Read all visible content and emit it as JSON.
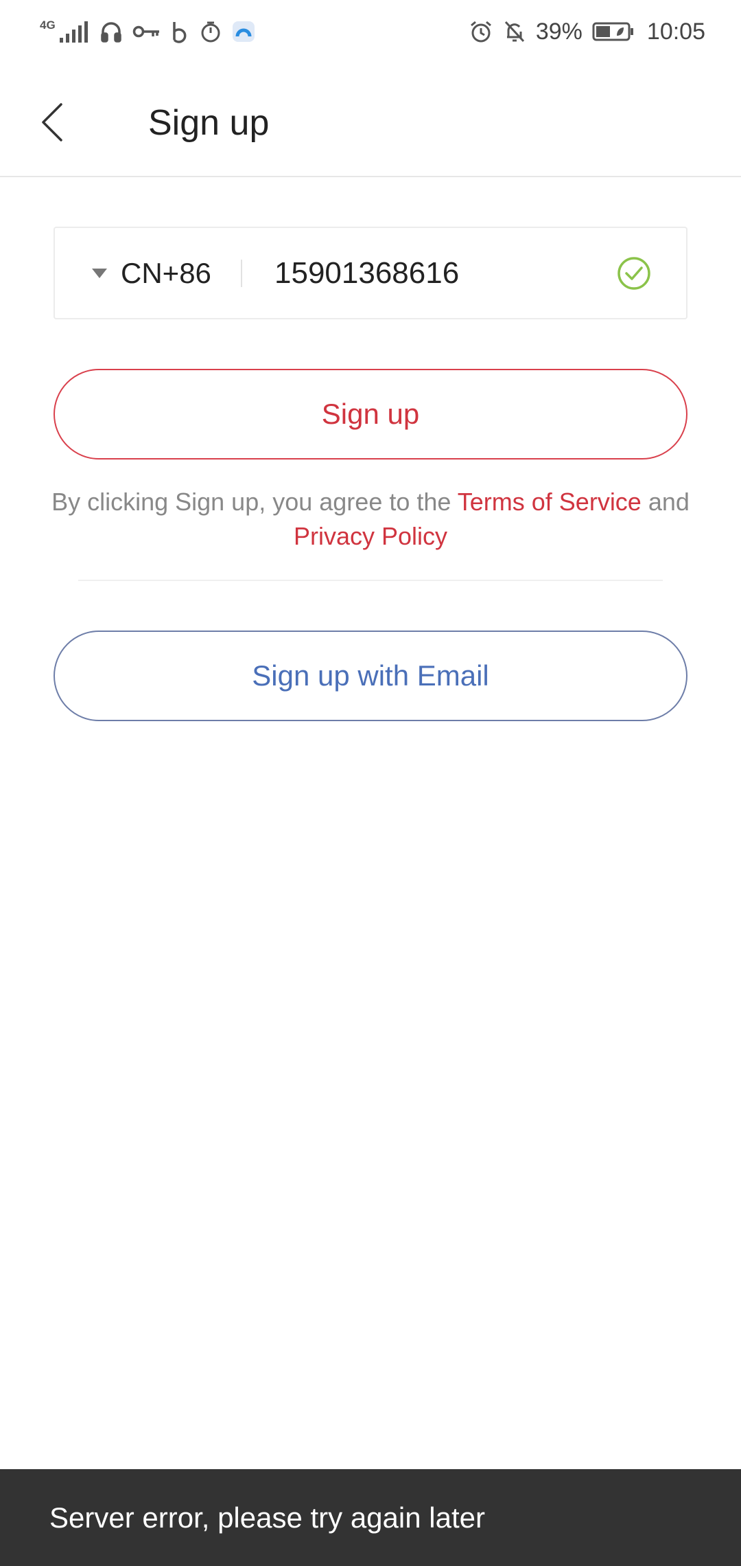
{
  "status_bar": {
    "network": "4G",
    "battery": "39%",
    "time": "10:05",
    "icons": [
      "signal-icon",
      "headset-icon",
      "key-icon",
      "b-app-icon",
      "timer-icon",
      "cloud-app-icon",
      "alarm-icon",
      "bell-off-icon",
      "battery-icon"
    ]
  },
  "header": {
    "title": "Sign up",
    "back_icon": "chevron-left-icon"
  },
  "phone_form": {
    "country_code": "CN+86",
    "phone_number": "15901368616",
    "valid_icon": "check-circle-icon",
    "valid_color": "#8bc34a"
  },
  "signup_button": {
    "label": "Sign up"
  },
  "terms": {
    "prefix": "By clicking Sign up, you agree to the ",
    "terms_link": "Terms of Service",
    "joiner": " and",
    "privacy_link": "Privacy Policy"
  },
  "email_button": {
    "label": "Sign up with Email"
  },
  "toast": {
    "message": "Server error, please try again later"
  },
  "colors": {
    "accent_red": "#d0343f",
    "accent_blue": "#4a6fb8",
    "toast_bg": "#333333"
  }
}
